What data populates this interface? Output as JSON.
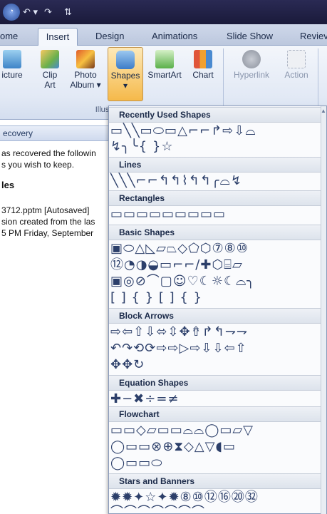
{
  "qat": {
    "office": "◔",
    "undo": "↶ ▾",
    "redo": "↷",
    "custom": "⇅"
  },
  "tabs": [
    "ome",
    "Insert",
    "Design",
    "Animations",
    "Slide Show",
    "Reviev"
  ],
  "ribbon": {
    "buttons": [
      {
        "label": "icture",
        "sub": ""
      },
      {
        "label": "Clip",
        "sub": "Art"
      },
      {
        "label": "Photo",
        "sub": "Album ▾"
      },
      {
        "label": "Shapes",
        "sub": "▾"
      },
      {
        "label": "SmartArt",
        "sub": ""
      },
      {
        "label": "Chart",
        "sub": ""
      },
      {
        "label": "Hyperlink",
        "sub": ""
      },
      {
        "label": "Action",
        "sub": ""
      }
    ],
    "group_label": "Illustr"
  },
  "doc": {
    "recovery_title": "ecovery",
    "line1": "as recovered the followin",
    "line2": "s you wish to keep.",
    "files_label": "les",
    "file_name": "3712.pptm  [Autosaved]",
    "file_desc": "sion created from the las",
    "file_time": "5 PM Friday, September"
  },
  "gallery": {
    "sections": [
      {
        "title": "Recently Used Shapes",
        "rows": [
          "▭╲╲▭⬭▭△⌐⌐↱⇨⇩⌓",
          "↯╮╰{ }☆"
        ]
      },
      {
        "title": "Lines",
        "rows": [
          "╲╲╲⌐⌐↰↰⌇↰↰╭⌓↯"
        ]
      },
      {
        "title": "Rectangles",
        "rows": [
          "▭▭▭▭▭▭▭▭▭"
        ]
      },
      {
        "title": "Basic Shapes",
        "rows": [
          "▣⬭△◺▱⏢◇⬠⬡⑦⑧⑩",
          "⑫◔◑◒▭⌐⌐∕✚⬡⌸▱",
          "▣◎⊘⌒▢☺♡☾☼☾⌓╮",
          "[ ] { } [ ] { }"
        ]
      },
      {
        "title": "Block Arrows",
        "rows": [
          "⇨⇦⇧⇩⬄⇳✥⇮↱↰⇁⇁",
          "↶↷⟲⟳⇨⇨▷⇨⇩⇩⇦⇧",
          "✥✥↻"
        ]
      },
      {
        "title": "Equation Shapes",
        "rows": [
          "✚−✖÷=≠"
        ]
      },
      {
        "title": "Flowchart",
        "rows": [
          "▭▭◇▱▭▭⌓⌓◯▭▱▽",
          "◯▭▭⊗⊕⧗◇△▽◖▭",
          "◯▭▭⬭"
        ]
      },
      {
        "title": "Stars and Banners",
        "rows": [
          "✹✹✦☆✦✹⑧⑩⑫⑯⑳㉜",
          "⌒⌒⌒⌒⌒⌒⌒"
        ]
      }
    ]
  },
  "colors": {
    "accent": "#f5b94a",
    "ribbon": "#e2e9f5",
    "title": "#1a1a3a"
  }
}
